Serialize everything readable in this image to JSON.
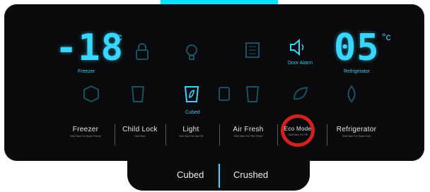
{
  "display": {
    "freezer_temp": "-18",
    "freezer_unit": "°c",
    "freezer_caption": "Freezer",
    "fridge_temp": "05",
    "fridge_unit": "°c",
    "fridge_caption": "Refrigerator",
    "door_alarm_caption": "Door Alarm",
    "cubed_caption": "Cubed"
  },
  "icons": [
    {
      "name": "lock-icon",
      "active": false
    },
    {
      "name": "light-bulb-icon",
      "active": false
    },
    {
      "name": "air-filter-icon",
      "active": false
    },
    {
      "name": "speaker-icon",
      "active": true
    },
    {
      "name": "ice-cube-icon",
      "active": false
    },
    {
      "name": "water-glass-icon",
      "active": false
    },
    {
      "name": "cubed-ice-icon",
      "active": true
    },
    {
      "name": "filter-icon",
      "active": false
    },
    {
      "name": "crushed-ice-icon",
      "active": false
    },
    {
      "name": "eco-leaf-icon",
      "active": false
    },
    {
      "name": "water-drop-icon",
      "active": false
    }
  ],
  "buttons": [
    {
      "label": "Freezer",
      "sub": "Hold 3sec For Super Freeze"
    },
    {
      "label": "Child Lock",
      "sub": "Hold 3sec"
    },
    {
      "label": "Light",
      "sub": "Hold 3sec For Vac Off"
    },
    {
      "label": "Air Fresh",
      "sub": "Hold 3sec For Filter Reset"
    },
    {
      "label": "Eco Mode",
      "sub": "Hold 3sec For Off"
    },
    {
      "label": "Refrigerator",
      "sub": "Hold 3sec For Super Cool"
    }
  ],
  "dispenser": {
    "cubed": "Cubed",
    "crushed": "Crushed"
  },
  "colors": {
    "accent": "#39d6ff",
    "highlight_ring": "#d5201b",
    "top_bar": "#00e5ff"
  }
}
